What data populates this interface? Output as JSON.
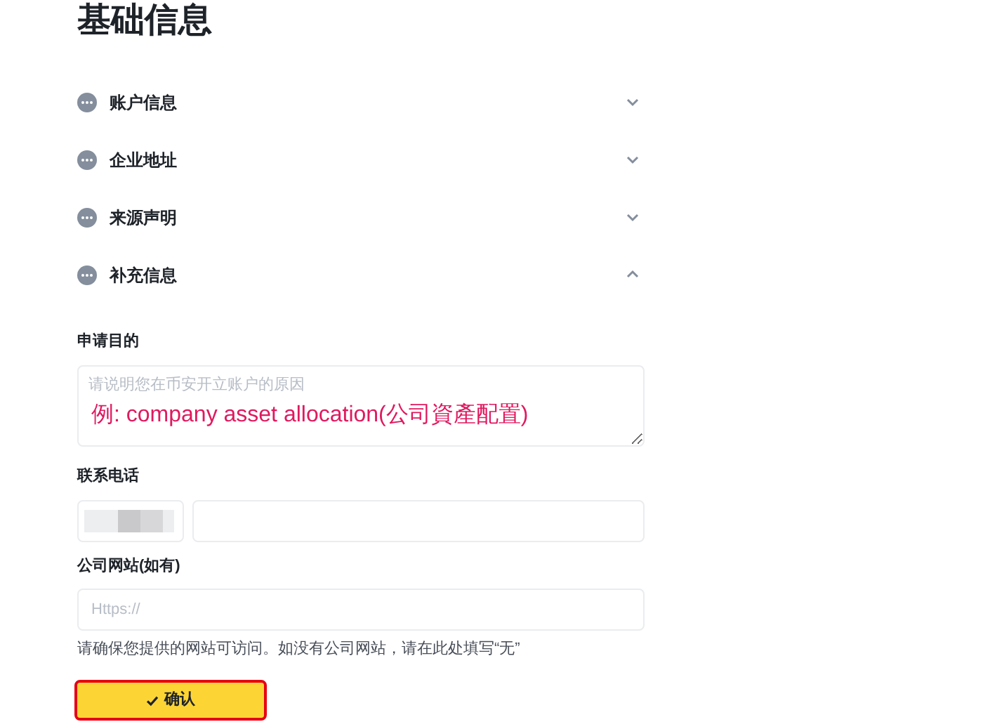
{
  "title": "基础信息",
  "sections": [
    {
      "label": "账户信息",
      "expanded": false
    },
    {
      "label": "企业地址",
      "expanded": false
    },
    {
      "label": "来源声明",
      "expanded": false
    },
    {
      "label": "补充信息",
      "expanded": true
    }
  ],
  "purpose": {
    "label": "申请目的",
    "placeholder": "请说明您在币安开立账户的原因",
    "annotation": "例: company asset allocation(公司資產配置)"
  },
  "phone": {
    "label": "联系电话"
  },
  "website": {
    "label": "公司网站(如有)",
    "placeholder": "Https://",
    "hint": "请确保您提供的网站可访问。如没有公司网站，请在此处填写“无”"
  },
  "confirm_button": {
    "label": "确认",
    "highlighted": true
  }
}
